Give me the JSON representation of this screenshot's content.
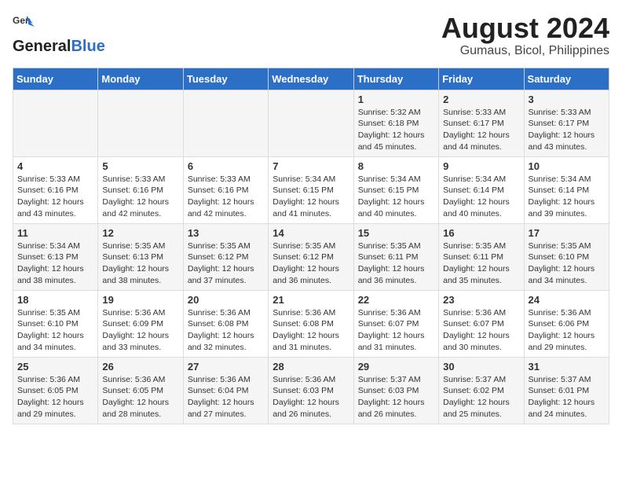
{
  "header": {
    "logo_general": "General",
    "logo_blue": "Blue",
    "month_title": "August 2024",
    "location": "Gumaus, Bicol, Philippines"
  },
  "days_of_week": [
    "Sunday",
    "Monday",
    "Tuesday",
    "Wednesday",
    "Thursday",
    "Friday",
    "Saturday"
  ],
  "weeks": [
    [
      {
        "day": "",
        "info": ""
      },
      {
        "day": "",
        "info": ""
      },
      {
        "day": "",
        "info": ""
      },
      {
        "day": "",
        "info": ""
      },
      {
        "day": "1",
        "info": "Sunrise: 5:32 AM\nSunset: 6:18 PM\nDaylight: 12 hours\nand 45 minutes."
      },
      {
        "day": "2",
        "info": "Sunrise: 5:33 AM\nSunset: 6:17 PM\nDaylight: 12 hours\nand 44 minutes."
      },
      {
        "day": "3",
        "info": "Sunrise: 5:33 AM\nSunset: 6:17 PM\nDaylight: 12 hours\nand 43 minutes."
      }
    ],
    [
      {
        "day": "4",
        "info": "Sunrise: 5:33 AM\nSunset: 6:16 PM\nDaylight: 12 hours\nand 43 minutes."
      },
      {
        "day": "5",
        "info": "Sunrise: 5:33 AM\nSunset: 6:16 PM\nDaylight: 12 hours\nand 42 minutes."
      },
      {
        "day": "6",
        "info": "Sunrise: 5:33 AM\nSunset: 6:16 PM\nDaylight: 12 hours\nand 42 minutes."
      },
      {
        "day": "7",
        "info": "Sunrise: 5:34 AM\nSunset: 6:15 PM\nDaylight: 12 hours\nand 41 minutes."
      },
      {
        "day": "8",
        "info": "Sunrise: 5:34 AM\nSunset: 6:15 PM\nDaylight: 12 hours\nand 40 minutes."
      },
      {
        "day": "9",
        "info": "Sunrise: 5:34 AM\nSunset: 6:14 PM\nDaylight: 12 hours\nand 40 minutes."
      },
      {
        "day": "10",
        "info": "Sunrise: 5:34 AM\nSunset: 6:14 PM\nDaylight: 12 hours\nand 39 minutes."
      }
    ],
    [
      {
        "day": "11",
        "info": "Sunrise: 5:34 AM\nSunset: 6:13 PM\nDaylight: 12 hours\nand 38 minutes."
      },
      {
        "day": "12",
        "info": "Sunrise: 5:35 AM\nSunset: 6:13 PM\nDaylight: 12 hours\nand 38 minutes."
      },
      {
        "day": "13",
        "info": "Sunrise: 5:35 AM\nSunset: 6:12 PM\nDaylight: 12 hours\nand 37 minutes."
      },
      {
        "day": "14",
        "info": "Sunrise: 5:35 AM\nSunset: 6:12 PM\nDaylight: 12 hours\nand 36 minutes."
      },
      {
        "day": "15",
        "info": "Sunrise: 5:35 AM\nSunset: 6:11 PM\nDaylight: 12 hours\nand 36 minutes."
      },
      {
        "day": "16",
        "info": "Sunrise: 5:35 AM\nSunset: 6:11 PM\nDaylight: 12 hours\nand 35 minutes."
      },
      {
        "day": "17",
        "info": "Sunrise: 5:35 AM\nSunset: 6:10 PM\nDaylight: 12 hours\nand 34 minutes."
      }
    ],
    [
      {
        "day": "18",
        "info": "Sunrise: 5:35 AM\nSunset: 6:10 PM\nDaylight: 12 hours\nand 34 minutes."
      },
      {
        "day": "19",
        "info": "Sunrise: 5:36 AM\nSunset: 6:09 PM\nDaylight: 12 hours\nand 33 minutes."
      },
      {
        "day": "20",
        "info": "Sunrise: 5:36 AM\nSunset: 6:08 PM\nDaylight: 12 hours\nand 32 minutes."
      },
      {
        "day": "21",
        "info": "Sunrise: 5:36 AM\nSunset: 6:08 PM\nDaylight: 12 hours\nand 31 minutes."
      },
      {
        "day": "22",
        "info": "Sunrise: 5:36 AM\nSunset: 6:07 PM\nDaylight: 12 hours\nand 31 minutes."
      },
      {
        "day": "23",
        "info": "Sunrise: 5:36 AM\nSunset: 6:07 PM\nDaylight: 12 hours\nand 30 minutes."
      },
      {
        "day": "24",
        "info": "Sunrise: 5:36 AM\nSunset: 6:06 PM\nDaylight: 12 hours\nand 29 minutes."
      }
    ],
    [
      {
        "day": "25",
        "info": "Sunrise: 5:36 AM\nSunset: 6:05 PM\nDaylight: 12 hours\nand 29 minutes."
      },
      {
        "day": "26",
        "info": "Sunrise: 5:36 AM\nSunset: 6:05 PM\nDaylight: 12 hours\nand 28 minutes."
      },
      {
        "day": "27",
        "info": "Sunrise: 5:36 AM\nSunset: 6:04 PM\nDaylight: 12 hours\nand 27 minutes."
      },
      {
        "day": "28",
        "info": "Sunrise: 5:36 AM\nSunset: 6:03 PM\nDaylight: 12 hours\nand 26 minutes."
      },
      {
        "day": "29",
        "info": "Sunrise: 5:37 AM\nSunset: 6:03 PM\nDaylight: 12 hours\nand 26 minutes."
      },
      {
        "day": "30",
        "info": "Sunrise: 5:37 AM\nSunset: 6:02 PM\nDaylight: 12 hours\nand 25 minutes."
      },
      {
        "day": "31",
        "info": "Sunrise: 5:37 AM\nSunset: 6:01 PM\nDaylight: 12 hours\nand 24 minutes."
      }
    ]
  ]
}
